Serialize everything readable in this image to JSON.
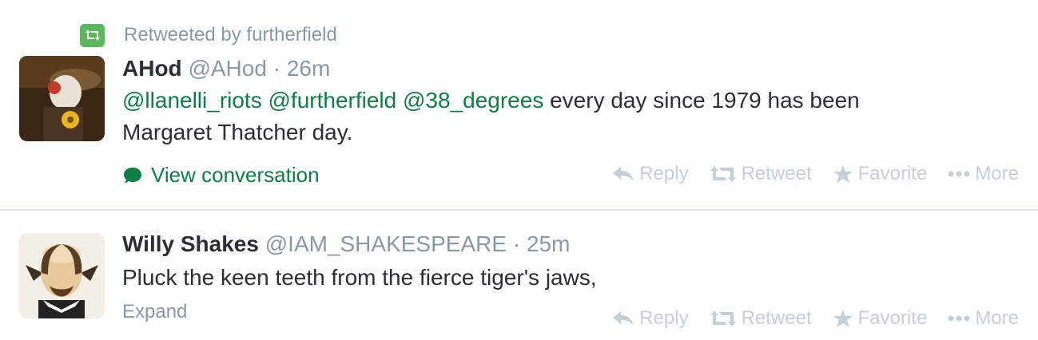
{
  "tweets": [
    {
      "context": "Retweeted by furtherfield",
      "fullname": "AHod",
      "username": "@AHod",
      "separator": "·",
      "time": "26m",
      "mentions": [
        "@llanelli_riots",
        "@furtherfield",
        "@38_degrees"
      ],
      "text_line1_rest": "every day since 1979 has been",
      "text_line2": "Margaret Thatcher day.",
      "view_conversation": "View conversation",
      "actions": {
        "reply": "Reply",
        "retweet": "Retweet",
        "favorite": "Favorite",
        "more": "More"
      }
    },
    {
      "fullname": "Willy Shakes",
      "username": "@IAM_SHAKESPEARE",
      "separator": "·",
      "time": "25m",
      "text": "Pluck the keen teeth from the fierce tiger's jaws,",
      "expand": "Expand",
      "actions": {
        "reply": "Reply",
        "retweet": "Retweet",
        "favorite": "Favorite",
        "more": "More"
      }
    }
  ],
  "colors": {
    "link_green": "#0b8043",
    "muted": "#8899a6",
    "action_gray": "#c5cfd6",
    "retweet_badge": "#5cb85c"
  }
}
